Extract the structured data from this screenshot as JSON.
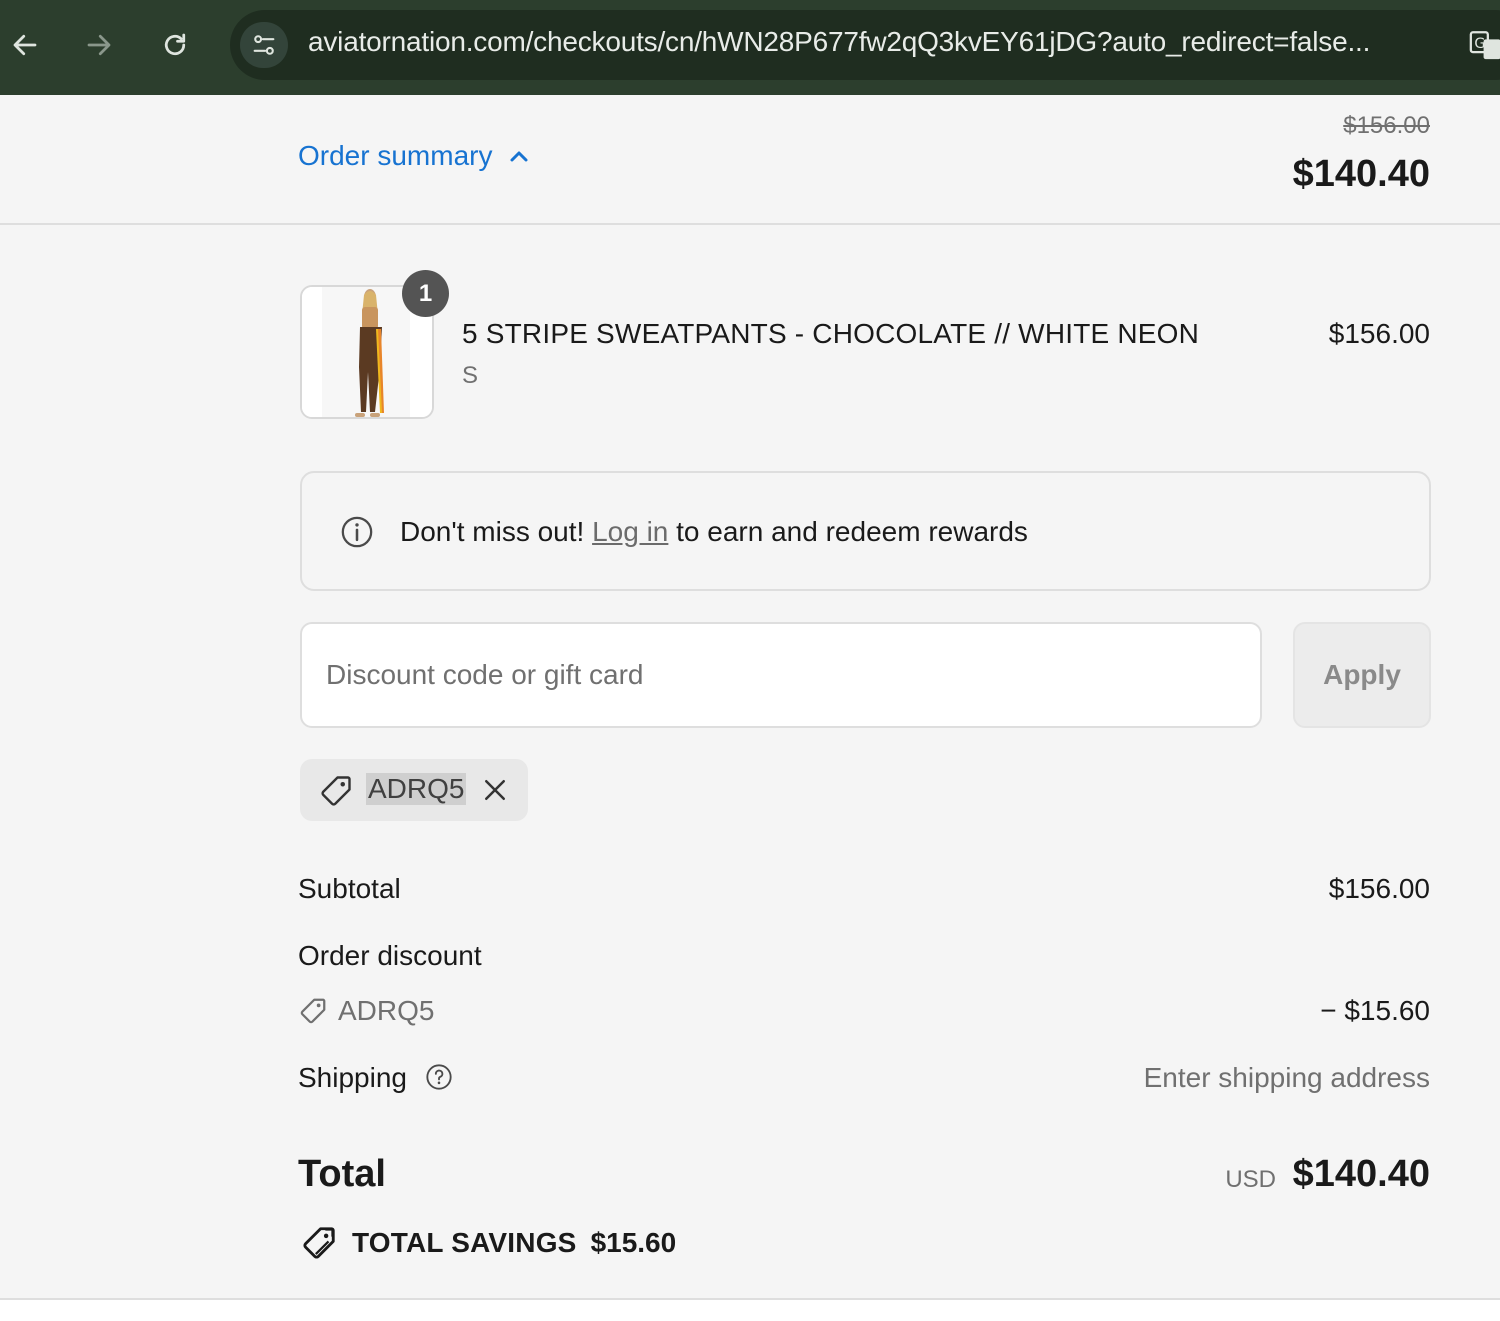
{
  "browser": {
    "url": "aviatornation.com/checkouts/cn/hWN28P677fw2qQ3kvEY61jDG?auto_redirect=false..."
  },
  "summary": {
    "toggle_label": "Order summary",
    "original_price": "$156.00",
    "current_price": "$140.40"
  },
  "product": {
    "quantity": "1",
    "name": "5 STRIPE SWEATPANTS - CHOCOLATE // WHITE NEON",
    "variant": "S",
    "price": "$156.00"
  },
  "rewards": {
    "prefix": "Don't miss out!",
    "link": "Log in",
    "suffix": "to earn and redeem rewards"
  },
  "discount": {
    "placeholder": "Discount code or gift card",
    "apply_label": "Apply",
    "applied_code": "ADRQ5"
  },
  "totals": {
    "subtotal_label": "Subtotal",
    "subtotal_value": "$156.00",
    "order_discount_label": "Order discount",
    "discount_code": "ADRQ5",
    "discount_value": "− $15.60",
    "shipping_label": "Shipping",
    "shipping_value": "Enter shipping address",
    "total_label": "Total",
    "currency": "USD",
    "total_value": "$140.40",
    "savings_label": "TOTAL SAVINGS",
    "savings_value": "$15.60"
  },
  "colors": {
    "link": "#1773d1",
    "chrome": "#2c3e2d"
  }
}
